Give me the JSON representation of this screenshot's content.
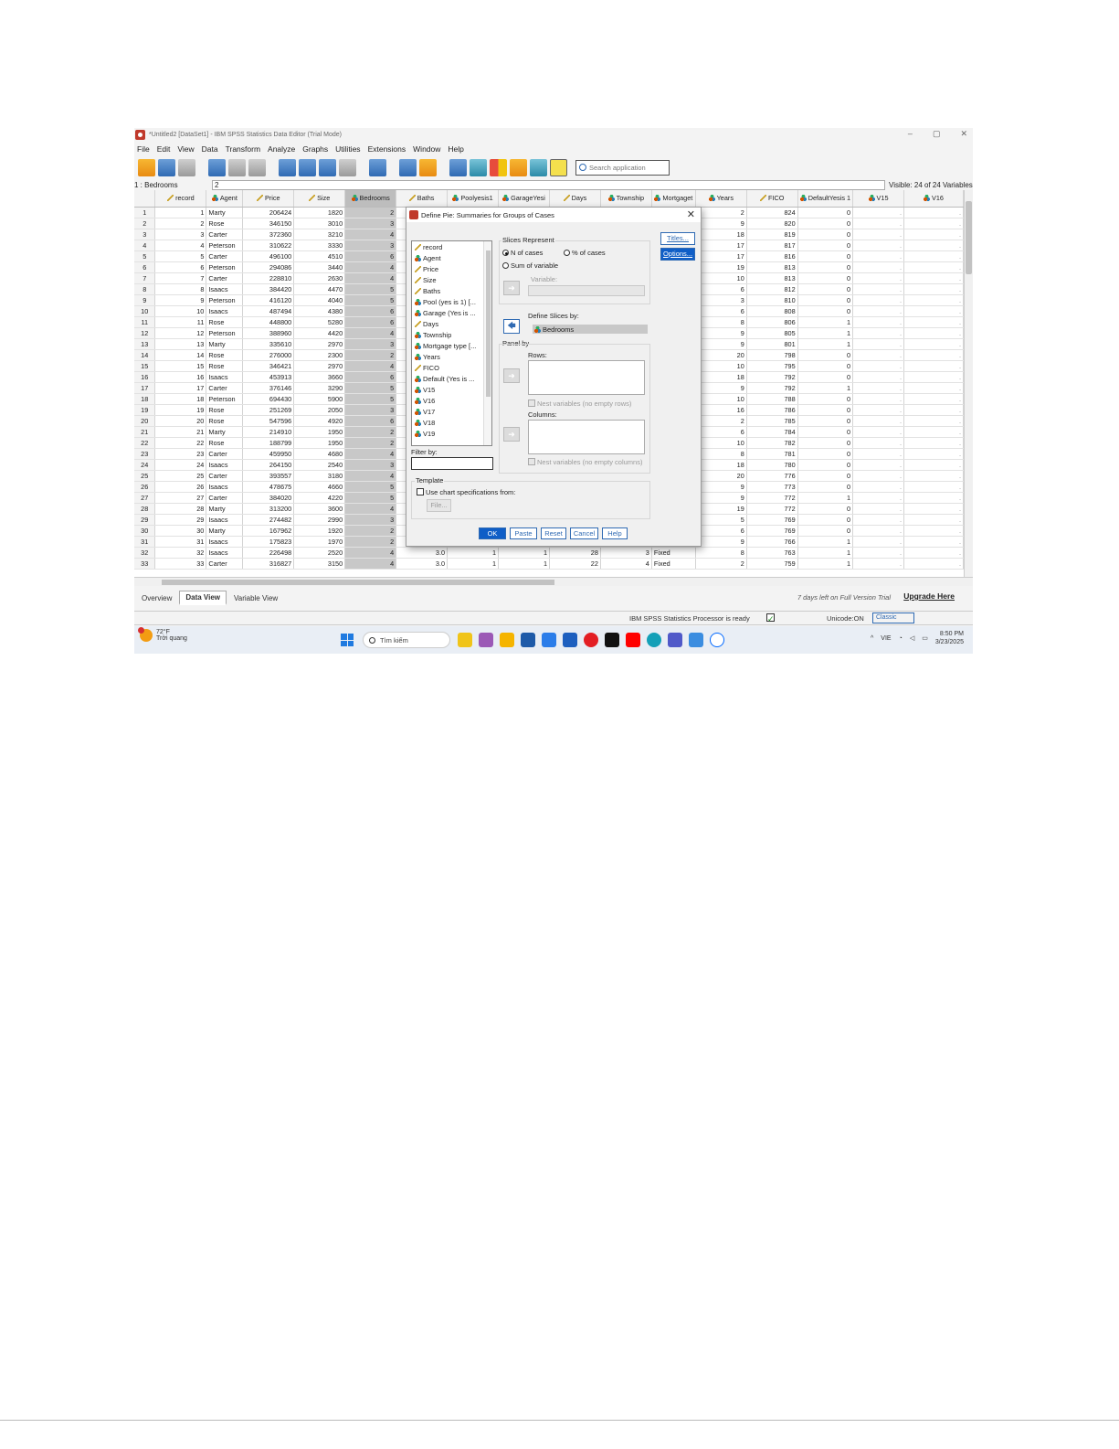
{
  "window": {
    "title": "*Untitled2 [DataSet1] - IBM SPSS Statistics Data Editor (Trial Mode)",
    "controls": [
      "–",
      "▢",
      "✕"
    ]
  },
  "menu": [
    "File",
    "Edit",
    "View",
    "Data",
    "Transform",
    "Analyze",
    "Graphs",
    "Utilities",
    "Extensions",
    "Window",
    "Help"
  ],
  "toolbar": {
    "search_placeholder": "Search application"
  },
  "cell_editor": {
    "ref": "1 : Bedrooms",
    "value": "2",
    "visible": "Visible: 24 of 24 Variables"
  },
  "grid": {
    "columns": [
      {
        "name": "record",
        "icon": "scale-icon"
      },
      {
        "name": "Agent",
        "icon": "nominal-icon"
      },
      {
        "name": "Price",
        "icon": "scale-icon"
      },
      {
        "name": "Size",
        "icon": "scale-icon"
      },
      {
        "name": "Bedrooms",
        "icon": "nominal-icon"
      },
      {
        "name": "Baths",
        "icon": "scale-icon"
      },
      {
        "name": "Poolyesis1",
        "icon": "nominal-icon"
      },
      {
        "name": "GarageYesi",
        "icon": "nominal-icon"
      },
      {
        "name": "Days",
        "icon": "scale-icon"
      },
      {
        "name": "Township",
        "icon": "nominal-icon"
      },
      {
        "name": "Mortgaget",
        "icon": "nominal-icon"
      },
      {
        "name": "Years",
        "icon": "nominal-icon"
      },
      {
        "name": "FICO",
        "icon": "scale-icon"
      },
      {
        "name": "DefaultYesis 1",
        "icon": "nominal-icon"
      },
      {
        "name": "V15",
        "icon": "nominal-icon"
      },
      {
        "name": "V16",
        "icon": "nominal-icon"
      }
    ],
    "rows": [
      [
        "1",
        "1",
        "Marty",
        "206424",
        "1820",
        "2",
        "",
        "",
        "",
        "",
        "",
        "",
        "2",
        "824",
        "0",
        ".",
        "."
      ],
      [
        "2",
        "2",
        "Rose",
        "346150",
        "3010",
        "3",
        "",
        "",
        "",
        "",
        "",
        "",
        "9",
        "820",
        "0",
        ".",
        "."
      ],
      [
        "3",
        "3",
        "Carter",
        "372360",
        "3210",
        "4",
        "",
        "",
        "",
        "",
        "",
        "",
        "18",
        "819",
        "0",
        ".",
        "."
      ],
      [
        "4",
        "4",
        "Peterson",
        "310622",
        "3330",
        "3",
        "",
        "",
        "",
        "",
        "",
        "",
        "17",
        "817",
        "0",
        ".",
        "."
      ],
      [
        "5",
        "5",
        "Carter",
        "496100",
        "4510",
        "6",
        "",
        "",
        "",
        "",
        "",
        "",
        "17",
        "816",
        "0",
        ".",
        "."
      ],
      [
        "6",
        "6",
        "Peterson",
        "294086",
        "3440",
        "4",
        "",
        "",
        "",
        "",
        "",
        "",
        "19",
        "813",
        "0",
        ".",
        "."
      ],
      [
        "7",
        "7",
        "Carter",
        "228810",
        "2630",
        "4",
        "",
        "",
        "",
        "",
        "",
        "",
        "10",
        "813",
        "0",
        ".",
        "."
      ],
      [
        "8",
        "8",
        "Isaacs",
        "384420",
        "4470",
        "5",
        "",
        "",
        "",
        "",
        "",
        "",
        "6",
        "812",
        "0",
        ".",
        "."
      ],
      [
        "9",
        "9",
        "Peterson",
        "416120",
        "4040",
        "5",
        "",
        "",
        "",
        "",
        "",
        "",
        "3",
        "810",
        "0",
        ".",
        "."
      ],
      [
        "10",
        "10",
        "Isaacs",
        "487494",
        "4380",
        "6",
        "",
        "",
        "",
        "",
        "",
        "",
        "6",
        "808",
        "0",
        ".",
        "."
      ],
      [
        "11",
        "11",
        "Rose",
        "448800",
        "5280",
        "6",
        "",
        "",
        "",
        "",
        "",
        "",
        "8",
        "806",
        "1",
        ".",
        "."
      ],
      [
        "12",
        "12",
        "Peterson",
        "388960",
        "4420",
        "4",
        "",
        "",
        "",
        "",
        "",
        "",
        "9",
        "805",
        "1",
        ".",
        "."
      ],
      [
        "13",
        "13",
        "Marty",
        "335610",
        "2970",
        "3",
        "",
        "",
        "",
        "",
        "",
        "",
        "9",
        "801",
        "1",
        ".",
        "."
      ],
      [
        "14",
        "14",
        "Rose",
        "276000",
        "2300",
        "2",
        "",
        "",
        "",
        "",
        "",
        "",
        "20",
        "798",
        "0",
        ".",
        "."
      ],
      [
        "15",
        "15",
        "Rose",
        "346421",
        "2970",
        "4",
        "",
        "",
        "",
        "",
        "",
        "",
        "10",
        "795",
        "0",
        ".",
        "."
      ],
      [
        "16",
        "16",
        "Isaacs",
        "453913",
        "3660",
        "6",
        "",
        "",
        "",
        "",
        "",
        "",
        "18",
        "792",
        "0",
        ".",
        "."
      ],
      [
        "17",
        "17",
        "Carter",
        "376146",
        "3290",
        "5",
        "",
        "",
        "",
        "",
        "",
        "",
        "9",
        "792",
        "1",
        ".",
        "."
      ],
      [
        "18",
        "18",
        "Peterson",
        "694430",
        "5900",
        "5",
        "",
        "",
        "",
        "",
        "",
        "",
        "10",
        "788",
        "0",
        ".",
        "."
      ],
      [
        "19",
        "19",
        "Rose",
        "251269",
        "2050",
        "3",
        "",
        "",
        "",
        "",
        "",
        "",
        "16",
        "786",
        "0",
        ".",
        "."
      ],
      [
        "20",
        "20",
        "Rose",
        "547596",
        "4920",
        "6",
        "",
        "",
        "",
        "",
        "",
        "",
        "2",
        "785",
        "0",
        ".",
        "."
      ],
      [
        "21",
        "21",
        "Marty",
        "214910",
        "1950",
        "2",
        "",
        "",
        "",
        "",
        "",
        "",
        "6",
        "784",
        "0",
        ".",
        "."
      ],
      [
        "22",
        "22",
        "Rose",
        "188799",
        "1950",
        "2",
        "",
        "",
        "",
        "",
        "",
        "",
        "10",
        "782",
        "0",
        ".",
        "."
      ],
      [
        "23",
        "23",
        "Carter",
        "459950",
        "4680",
        "4",
        "",
        "",
        "",
        "",
        "",
        "",
        "8",
        "781",
        "0",
        ".",
        "."
      ],
      [
        "24",
        "24",
        "Isaacs",
        "264150",
        "2540",
        "3",
        "",
        "",
        "",
        "",
        "",
        "",
        "18",
        "780",
        "0",
        ".",
        "."
      ],
      [
        "25",
        "25",
        "Carter",
        "393557",
        "3180",
        "4",
        "",
        "",
        "",
        "",
        "",
        "",
        "20",
        "776",
        "0",
        ".",
        "."
      ],
      [
        "26",
        "26",
        "Isaacs",
        "478675",
        "4660",
        "5",
        "",
        "",
        "",
        "",
        "",
        "",
        "9",
        "773",
        "0",
        ".",
        "."
      ],
      [
        "27",
        "27",
        "Carter",
        "384020",
        "4220",
        "5",
        "",
        "",
        "",
        "",
        "",
        "",
        "9",
        "772",
        "1",
        ".",
        "."
      ],
      [
        "28",
        "28",
        "Marty",
        "313200",
        "3600",
        "4",
        "",
        "",
        "",
        "",
        "",
        "",
        "19",
        "772",
        "0",
        ".",
        "."
      ],
      [
        "29",
        "29",
        "Isaacs",
        "274482",
        "2990",
        "3",
        "",
        "",
        "",
        "",
        "",
        "",
        "5",
        "769",
        "0",
        ".",
        "."
      ],
      [
        "30",
        "30",
        "Marty",
        "167962",
        "1920",
        "2",
        "",
        "",
        "",
        "",
        "",
        "",
        "6",
        "769",
        "0",
        ".",
        "."
      ],
      [
        "31",
        "31",
        "Isaacs",
        "175823",
        "1970",
        "2",
        "",
        "",
        "",
        "",
        "",
        "",
        "9",
        "766",
        "1",
        ".",
        "."
      ],
      [
        "32",
        "32",
        "Isaacs",
        "226498",
        "2520",
        "4",
        "3.0",
        "1",
        "1",
        "28",
        "3",
        "Fixed",
        "8",
        "763",
        "1",
        ".",
        "."
      ],
      [
        "33",
        "33",
        "Carter",
        "316827",
        "3150",
        "4",
        "3.0",
        "1",
        "1",
        "22",
        "4",
        "Fixed",
        "2",
        "759",
        "1",
        ".",
        "."
      ]
    ]
  },
  "tabs": {
    "overview": "Overview",
    "data_view": "Data View",
    "variable_view": "Variable View"
  },
  "trial": {
    "text": "7 days left on Full Version Trial",
    "upgrade": "Upgrade Here"
  },
  "status": {
    "processor": "IBM SPSS Statistics Processor is ready",
    "unicode": "Unicode:ON",
    "classic": "Classic"
  },
  "taskbar": {
    "temp": "72°F",
    "weather": "Trời quang",
    "search": "Tìm kiếm",
    "lang": "VIE",
    "time": "8:50 PM",
    "date": "3/23/2025"
  },
  "dialog": {
    "title": "Define Pie: Summaries for Groups of Cases",
    "variables": [
      "record",
      "Agent",
      "Price",
      "Size",
      "Baths",
      "Pool (yes is 1) [...",
      "Garage (Yes is ...",
      "Days",
      "Township",
      "Mortgage type [...",
      "Years",
      "FICO",
      "Default (Yes is ...",
      "V15",
      "V16",
      "V17",
      "V18",
      "V19"
    ],
    "variable_icons": [
      "scale-icon",
      "nominal-icon",
      "scale-icon",
      "scale-icon",
      "scale-icon",
      "nominal-icon",
      "nominal-icon",
      "scale-icon",
      "nominal-icon",
      "nominal-icon",
      "nominal-icon",
      "scale-icon",
      "nominal-icon",
      "nominal-icon",
      "nominal-icon",
      "nominal-icon",
      "nominal-icon",
      "nominal-icon"
    ],
    "slices_represent": "Slices Represent",
    "n_of_cases": "N of cases",
    "pct_of_cases": "% of cases",
    "sum_of_variable": "Sum of variable",
    "variable_label": "Variable:",
    "define_slices_by": "Define Slices by:",
    "slice_variable": "Bedrooms",
    "panel_by": "Panel by",
    "rows": "Rows:",
    "nest_rows": "Nest variables (no empty rows)",
    "columns": "Columns:",
    "nest_columns": "Nest variables (no empty columns)",
    "filter_by": "Filter by:",
    "template": "Template",
    "use_chart_spec": "Use chart specifications from:",
    "file": "File...",
    "titles": "Titles...",
    "options": "Options...",
    "ok": "OK",
    "paste": "Paste",
    "reset": "Reset",
    "cancel": "Cancel",
    "help": "Help"
  }
}
